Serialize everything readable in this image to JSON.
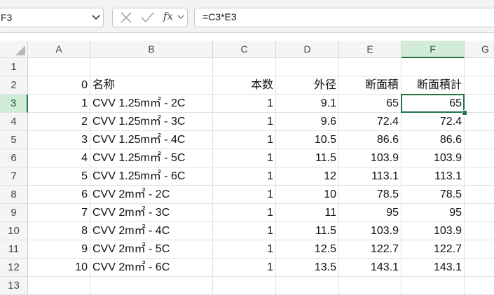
{
  "name_box": {
    "value": "F3"
  },
  "formula_bar": {
    "value": "=C3*E3",
    "fx_label": "fx"
  },
  "columns": [
    "A",
    "B",
    "C",
    "D",
    "E",
    "F",
    "G"
  ],
  "selected_column": "F",
  "rows": [
    {
      "num": "1",
      "cells": [
        "",
        "",
        "",
        "",
        "",
        ""
      ]
    },
    {
      "num": "2",
      "cells": [
        "0",
        "名称",
        "本数",
        "外径",
        "断面積",
        "断面積計"
      ]
    },
    {
      "num": "3",
      "cells": [
        "1",
        "CVV 1.25m㎡ - 2C",
        "1",
        "9.1",
        "65",
        "65"
      ]
    },
    {
      "num": "4",
      "cells": [
        "2",
        "CVV 1.25m㎡ - 3C",
        "1",
        "9.6",
        "72.4",
        "72.4"
      ]
    },
    {
      "num": "5",
      "cells": [
        "3",
        "CVV 1.25m㎡ - 4C",
        "1",
        "10.5",
        "86.6",
        "86.6"
      ]
    },
    {
      "num": "6",
      "cells": [
        "4",
        "CVV 1.25m㎡ - 5C",
        "1",
        "11.5",
        "103.9",
        "103.9"
      ]
    },
    {
      "num": "7",
      "cells": [
        "5",
        "CVV 1.25m㎡ - 6C",
        "1",
        "12",
        "113.1",
        "113.1"
      ]
    },
    {
      "num": "8",
      "cells": [
        "6",
        "CVV 2m㎡ - 2C",
        "1",
        "10",
        "78.5",
        "78.5"
      ]
    },
    {
      "num": "9",
      "cells": [
        "7",
        "CVV 2m㎡ - 3C",
        "1",
        "11",
        "95",
        "95"
      ]
    },
    {
      "num": "10",
      "cells": [
        "8",
        "CVV 2m㎡ - 4C",
        "1",
        "11.5",
        "103.9",
        "103.9"
      ]
    },
    {
      "num": "11",
      "cells": [
        "9",
        "CVV 2m㎡ - 5C",
        "1",
        "12.5",
        "122.7",
        "122.7"
      ]
    },
    {
      "num": "12",
      "cells": [
        "10",
        "CVV 2m㎡ - 6C",
        "1",
        "13.5",
        "143.1",
        "143.1"
      ]
    },
    {
      "num": "13",
      "cells": [
        "",
        "",
        "",
        "",
        "",
        ""
      ]
    }
  ],
  "selected_row": "3",
  "active_cell": "F3",
  "colors": {
    "accent": "#217346",
    "header_selected": "#d3ecd9"
  }
}
